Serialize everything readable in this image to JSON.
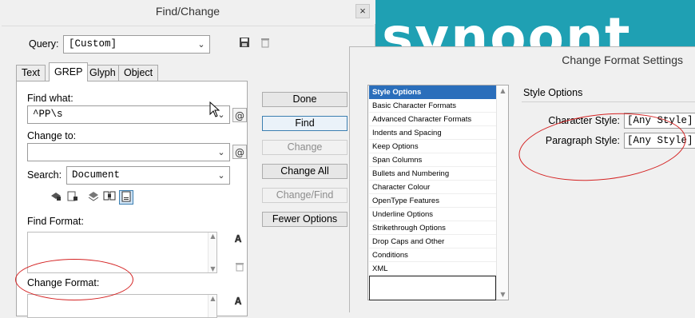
{
  "find_change": {
    "title": "Find/Change",
    "close": "×",
    "query_label": "Query:",
    "query_value": "[Custom]",
    "tabs": [
      "Text",
      "GREP",
      "Glyph",
      "Object"
    ],
    "find_what_label": "Find what:",
    "find_what_value": "^PP\\s",
    "change_to_label": "Change to:",
    "change_to_value": "",
    "search_label": "Search:",
    "search_value": "Document",
    "find_format_label": "Find Format:",
    "change_format_label": "Change Format:",
    "buttons": {
      "done": "Done",
      "find": "Find",
      "change": "Change",
      "change_all": "Change All",
      "change_find": "Change/Find",
      "fewer_options": "Fewer Options"
    }
  },
  "background": {
    "text": "synoont",
    "color": "#1fa0b3"
  },
  "change_format_settings": {
    "title": "Change Format Settings",
    "categories": [
      "Style Options",
      "Basic Character Formats",
      "Advanced Character Formats",
      "Indents and Spacing",
      "Keep Options",
      "Span Columns",
      "Bullets and Numbering",
      "Character Colour",
      "OpenType Features",
      "Underline Options",
      "Strikethrough Options",
      "Drop Caps and Other",
      "Conditions",
      "XML"
    ],
    "selected_category": "Style Options",
    "heading": "Style Options",
    "character_style_label": "Character Style:",
    "character_style_value": "[Any Style]",
    "paragraph_style_label": "Paragraph Style:",
    "paragraph_style_value": "[Any Style]"
  },
  "colors": {
    "selection": "#2a6ebb",
    "annotation": "#d42222",
    "focus": "#3c7fb1"
  }
}
